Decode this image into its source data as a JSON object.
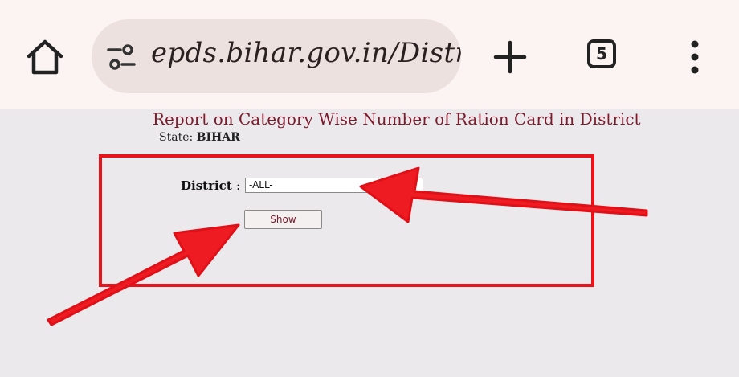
{
  "browser": {
    "url": "epds.bihar.gov.in/District",
    "tab_count": "5",
    "icons": [
      "home-icon",
      "site-settings-icon",
      "plus-icon",
      "tab-switcher-icon",
      "more-vert-icon"
    ]
  },
  "report": {
    "title": "Report on Category Wise Number of Ration Card in District",
    "state_label": "State:",
    "state_value": "BIHAR"
  },
  "form": {
    "district_label": "District",
    "district_colon": ":",
    "district_value": "-ALL-",
    "show_label": "Show"
  },
  "colors": {
    "accent_red": "#e8141c",
    "title_maroon": "#7b1b2c"
  }
}
